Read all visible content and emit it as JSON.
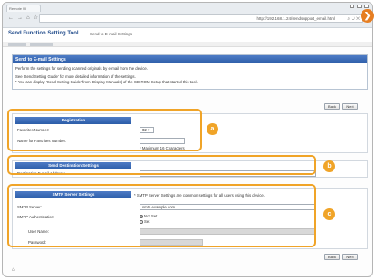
{
  "browser": {
    "tab_label": "Remote UI",
    "address": "http://192.168.1.24/sendsupport_email.html",
    "nav_back": "←",
    "nav_forward": "→",
    "nav_home": "⌂",
    "nav_star": "☆",
    "nav_refresh": "↻",
    "address_icons": "⌕ ↻ ✕",
    "go_arrow": "❯"
  },
  "header": {
    "title": "Send Function Setting Tool",
    "subtitle": "Send to E-mail Settings"
  },
  "intro": {
    "title": "Send to E-mail Settings",
    "line1": "Perform the settings for sending scanned originals by e-mail from the device.",
    "line2": "See 'Send Setting Guide' for more detailed information of the settings.",
    "line3": "* You can display 'Send Setting Guide' from [Display Manuals] of the CD-ROM Setup that started this tool."
  },
  "buttons": {
    "back": "Back",
    "next": "Next"
  },
  "registration": {
    "title": "Registration",
    "favorites_label": "Favorites Number:",
    "favorites_value": "02",
    "name_label": "Name for Favorites Number:",
    "name_value": "",
    "max_note": "* Maximum 16 Characters"
  },
  "destination": {
    "title": "Send Destination Settings",
    "address_label": "Destination E-mail Address:",
    "address_value": ""
  },
  "smtp": {
    "title": "SMTP Server Settings",
    "note": "* SMTP Server Settings are common settings for all users using this device.",
    "server_label": "SMTP Server:",
    "server_value": "smtp.example.com",
    "auth_label": "SMTP Authentication:",
    "auth_option_not_set": "Not Set",
    "auth_option_set": "Set",
    "auth_selected": "Not Set",
    "user_label": "User Name:",
    "password_label": "Password:"
  },
  "callouts": {
    "a": "a",
    "b": "b",
    "c": "c"
  },
  "footer_icon": "⌂",
  "colors": {
    "accent": "#2c5da8",
    "callout": "#f0a428"
  }
}
